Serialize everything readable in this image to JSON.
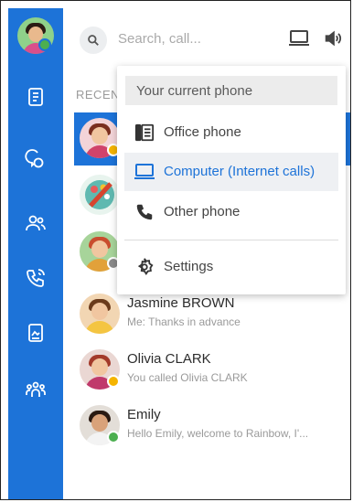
{
  "search": {
    "placeholder": "Search, call..."
  },
  "recent_label": "RECEN",
  "phone_menu": {
    "header": "Your current phone",
    "items": [
      {
        "label": "Office phone",
        "icon": "desk-phone-icon",
        "selected": false
      },
      {
        "label": "Computer (Internet calls)",
        "icon": "laptop-icon",
        "selected": true
      },
      {
        "label": "Other phone",
        "icon": "phone-handset-icon",
        "selected": false
      }
    ],
    "settings": "Settings"
  },
  "conversations": [
    {
      "name": "",
      "sub": "",
      "status": "yellow",
      "active": true
    },
    {
      "name": "",
      "sub": "",
      "status": "",
      "active": false
    },
    {
      "name": "",
      "sub": "",
      "status": "grey",
      "active": false
    },
    {
      "name": "Jasmine BROWN",
      "sub": "Me: Thanks in advance",
      "status": "",
      "active": false
    },
    {
      "name": "Olivia CLARK",
      "sub": "You called Olivia CLARK",
      "status": "yellow",
      "active": false
    },
    {
      "name": "Emily",
      "sub": "Hello Emily, welcome to Rainbow, I'...",
      "status": "green",
      "active": false
    }
  ],
  "colors": {
    "accent": "#1d73d8",
    "available": "#4caf50",
    "away": "#f5b400",
    "offline": "#8a8a8a"
  }
}
